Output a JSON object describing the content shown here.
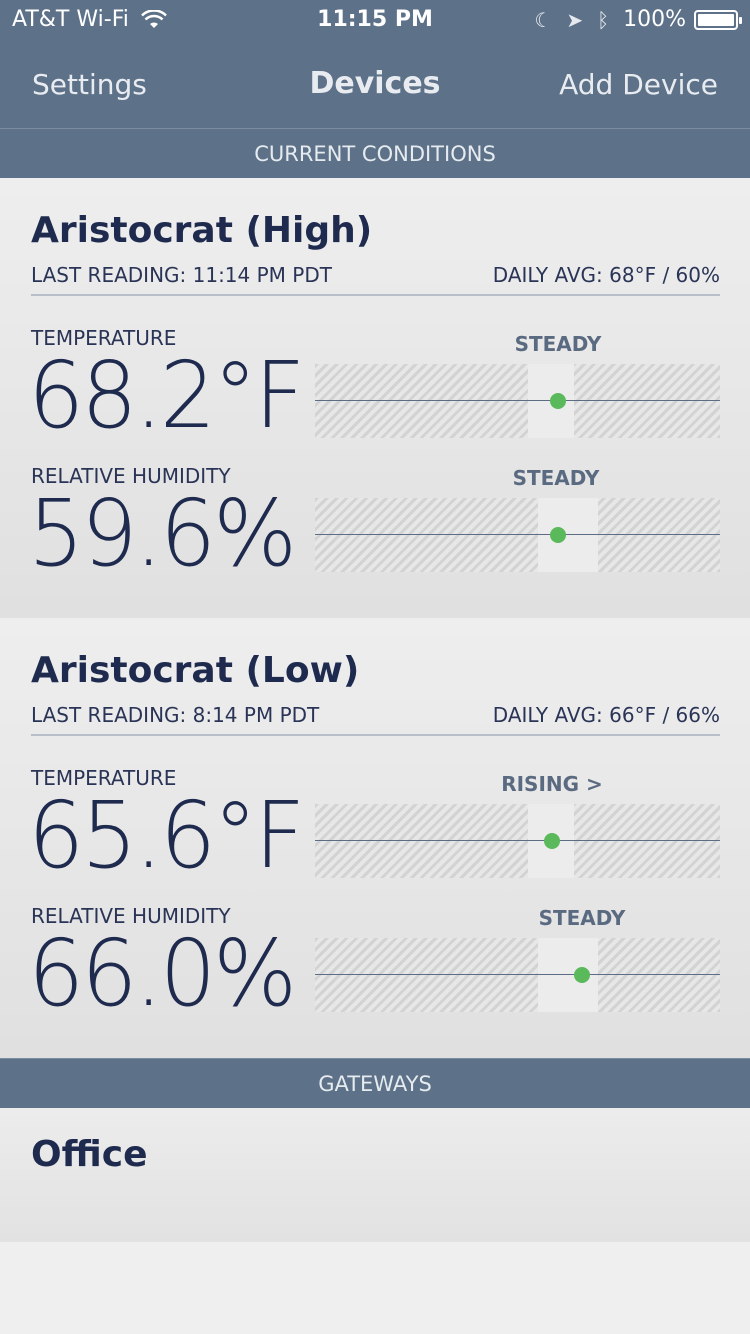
{
  "status_bar": {
    "carrier": "AT&T Wi-Fi",
    "time": "11:15 PM",
    "battery": "100%",
    "battery_level": 1.0
  },
  "nav": {
    "left": "Settings",
    "title": "Devices",
    "right": "Add Device"
  },
  "sections": {
    "current_conditions": "CURRENT CONDITIONS",
    "gateways": "GATEWAYS"
  },
  "devices": [
    {
      "name": "Aristocrat (High)",
      "last_reading": "LAST READING: 11:14 PM PDT",
      "daily_avg": "DAILY AVG: 68°F / 60%",
      "temperature": {
        "label": "TEMPERATURE",
        "value": "68.2°F",
        "trend": "STEADY",
        "marker": 0.6
      },
      "humidity": {
        "label": "RELATIVE HUMIDITY",
        "value": "59.6%",
        "trend": "STEADY",
        "marker": 0.6
      }
    },
    {
      "name": "Aristocrat (Low)",
      "last_reading": "LAST READING: 8:14 PM PDT",
      "daily_avg": "DAILY AVG: 66°F / 66%",
      "temperature": {
        "label": "TEMPERATURE",
        "value": "65.6°F",
        "trend": "RISING >",
        "marker": 0.585
      },
      "humidity": {
        "label": "RELATIVE HUMIDITY",
        "value": "66.0%",
        "trend": "STEADY",
        "marker": 0.66
      }
    }
  ],
  "gateways": [
    {
      "name": "Office"
    }
  ],
  "colors": {
    "header": "#5d7189",
    "text": "#1e2a4e",
    "dot": "#5ab95a"
  }
}
